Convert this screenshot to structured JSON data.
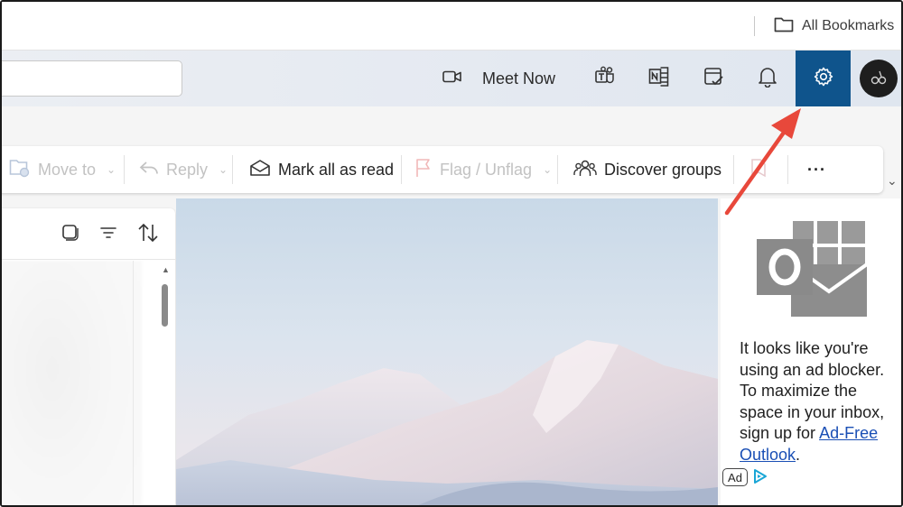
{
  "browser": {
    "bookmarks_label": "All Bookmarks"
  },
  "header": {
    "search_placeholder": "",
    "meet_now_label": "Meet Now"
  },
  "ribbon": {
    "move_to": "Move to",
    "reply": "Reply",
    "mark_all_read": "Mark all as read",
    "flag_unflag": "Flag / Unflag",
    "discover_groups": "Discover groups",
    "more": "···"
  },
  "ad": {
    "text_before_link": "It looks like you're using an ad blocker. To maximize the space in your inbox, sign up for ",
    "link_text": "Ad-Free Outlook",
    "text_after_link": ".",
    "badge": "Ad"
  },
  "colors": {
    "settings_active_bg": "#0f548c",
    "annotation_arrow": "#e8483b",
    "link": "#1a4fb5"
  },
  "icons": [
    "folder-icon",
    "video-camera-icon",
    "teams-icon",
    "onenote-icon",
    "todo-icon",
    "bell-icon",
    "gear-icon",
    "avatar",
    "move-folder-icon",
    "reply-icon",
    "envelope-open-icon",
    "flag-icon",
    "people-icon",
    "tag-icon",
    "select-icon",
    "filter-icon",
    "sort-icon",
    "outlook-logo-icon",
    "adchoices-icon"
  ]
}
